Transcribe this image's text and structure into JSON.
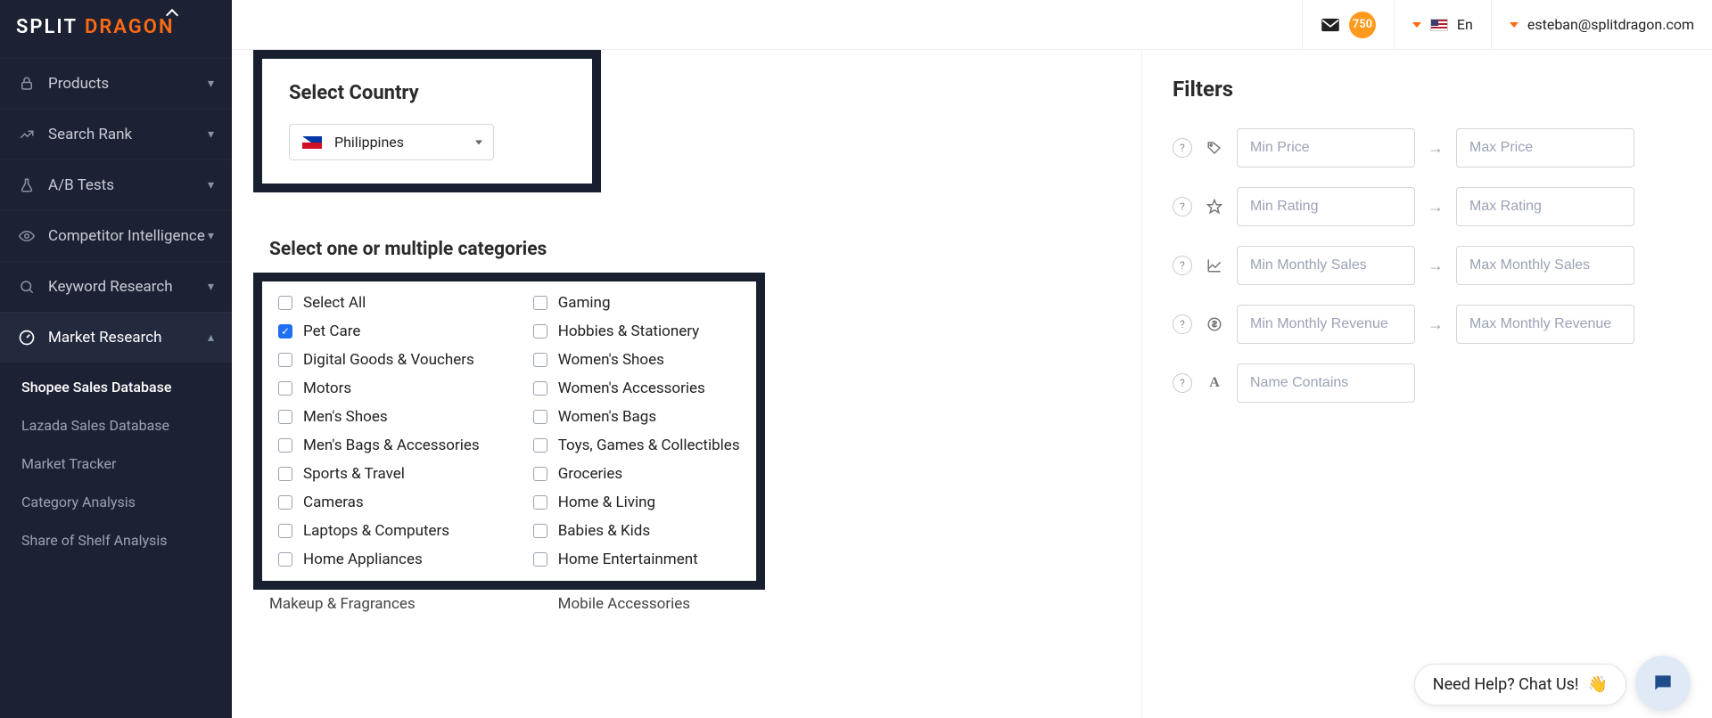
{
  "brand": {
    "split": "SPLIT",
    "dragon": "DRAGON"
  },
  "topbar": {
    "mail_count": "750",
    "lang": "En",
    "user": "esteban@splitdragon.com"
  },
  "sidebar": {
    "items": [
      {
        "label": "Products",
        "expanded": false
      },
      {
        "label": "Search Rank",
        "expanded": false
      },
      {
        "label": "A/B Tests",
        "expanded": false
      },
      {
        "label": "Competitor Intelligence",
        "expanded": false
      },
      {
        "label": "Keyword Research",
        "expanded": false
      },
      {
        "label": "Market Research",
        "expanded": true
      }
    ],
    "sub_items": [
      {
        "label": "Shopee Sales Database",
        "active": true
      },
      {
        "label": "Lazada Sales Database",
        "active": false
      },
      {
        "label": "Market Tracker",
        "active": false
      },
      {
        "label": "Category Analysis",
        "active": false
      },
      {
        "label": "Share of Shelf Analysis",
        "active": false
      }
    ]
  },
  "country": {
    "title": "Select Country",
    "selected": "Philippines"
  },
  "categories": {
    "title": "Select one or multiple categories",
    "col1": [
      {
        "label": "Select All",
        "checked": false
      },
      {
        "label": "Pet Care",
        "checked": true
      },
      {
        "label": "Digital Goods & Vouchers",
        "checked": false
      },
      {
        "label": "Motors",
        "checked": false
      },
      {
        "label": "Men's Shoes",
        "checked": false
      },
      {
        "label": "Men's Bags & Accessories",
        "checked": false
      },
      {
        "label": "Sports & Travel",
        "checked": false
      },
      {
        "label": "Cameras",
        "checked": false
      },
      {
        "label": "Laptops & Computers",
        "checked": false
      },
      {
        "label": "Home Appliances",
        "checked": false
      }
    ],
    "col2": [
      {
        "label": "Gaming",
        "checked": false
      },
      {
        "label": "Hobbies & Stationery",
        "checked": false
      },
      {
        "label": "Women's Shoes",
        "checked": false
      },
      {
        "label": "Women's Accessories",
        "checked": false
      },
      {
        "label": "Women's Bags",
        "checked": false
      },
      {
        "label": "Toys, Games & Collectibles",
        "checked": false
      },
      {
        "label": "Groceries",
        "checked": false
      },
      {
        "label": "Home & Living",
        "checked": false
      },
      {
        "label": "Babies & Kids",
        "checked": false
      },
      {
        "label": "Home Entertainment",
        "checked": false
      }
    ],
    "below_col1": "Makeup & Fragrances",
    "below_col2": "Mobile Accessories"
  },
  "filters": {
    "title": "Filters",
    "rows": [
      {
        "icon": "tag",
        "min": "Min Price",
        "max": "Max Price"
      },
      {
        "icon": "star",
        "min": "Min Rating",
        "max": "Max Rating"
      },
      {
        "icon": "chart",
        "min": "Min Monthly Sales",
        "max": "Max Monthly Sales"
      },
      {
        "icon": "dollar",
        "min": "Min Monthly Revenue",
        "max": "Max Monthly Revenue"
      }
    ],
    "name_contains": "Name Contains"
  },
  "chat": {
    "label": "Need Help? Chat Us!"
  }
}
